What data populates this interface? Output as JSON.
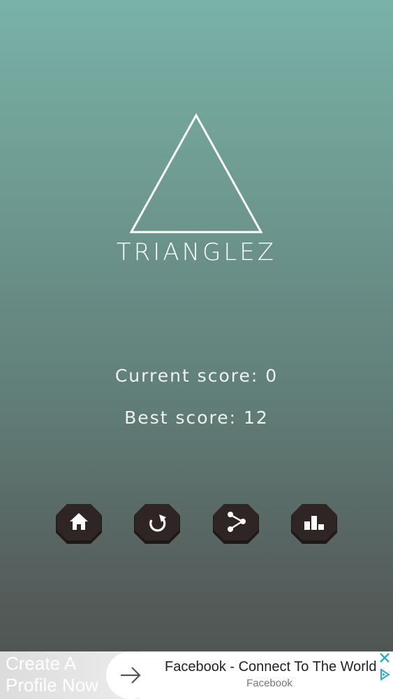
{
  "game": {
    "title": "TRIANGLEZ",
    "logo_icon": "triangle-outline-icon"
  },
  "scores": {
    "current_label": "Current score: 0",
    "best_label": "Best score: 12",
    "current_value": 0,
    "best_value": 12
  },
  "buttons": [
    {
      "name": "home",
      "icon": "home-icon"
    },
    {
      "name": "restart",
      "icon": "restart-icon"
    },
    {
      "name": "share",
      "icon": "share-icon"
    },
    {
      "name": "leaderboard",
      "icon": "leaderboard-icon"
    }
  ],
  "ad": {
    "left_text": "Create A\nProfile Now",
    "title": "Facebook - Connect To The World",
    "subtitle": "Facebook",
    "close_icon": "close-icon",
    "adchoices_icon": "adchoices-icon",
    "arrow_icon": "arrow-right-icon"
  },
  "colors": {
    "background_top": "#79b2a7",
    "background_bottom": "#4e5150",
    "button_fill": "#2b2322",
    "text": "#ffffff",
    "ad_accent": "#29a8e0"
  }
}
